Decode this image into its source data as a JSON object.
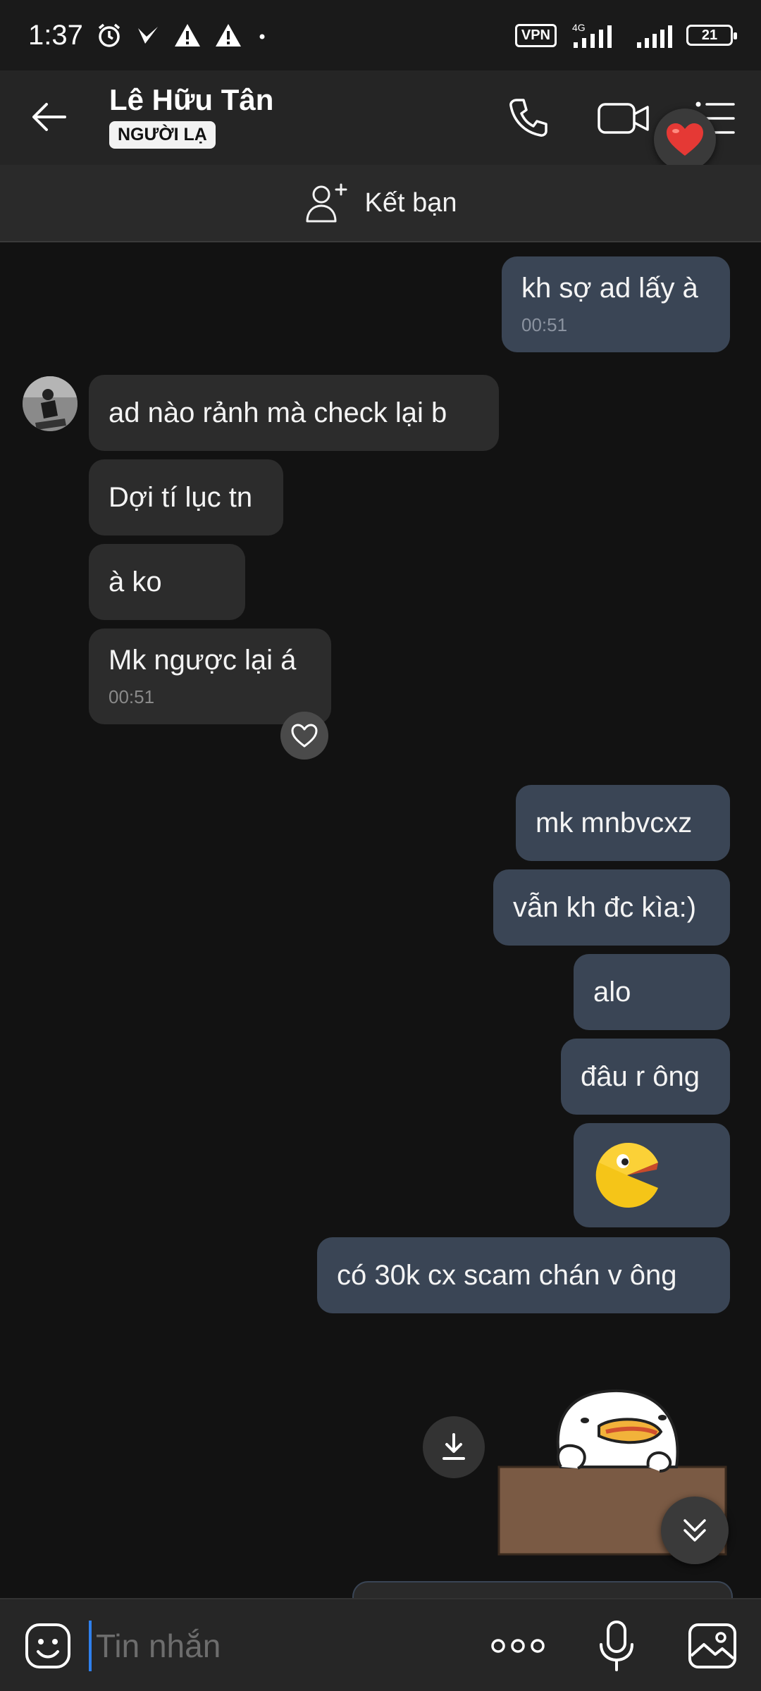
{
  "status_bar": {
    "time": "1:37",
    "vpn": "VPN",
    "network": "4G",
    "battery": "21"
  },
  "header": {
    "contact_name": "Lê Hữu Tân",
    "badge": "NGƯỜI LẠ"
  },
  "add_friend": {
    "label": "Kết bạn"
  },
  "messages": [
    {
      "dir": "out",
      "text": "kh sợ ad lấy à",
      "time": "00:51"
    },
    {
      "dir": "in",
      "text": "ad nào rảnh mà check lại b"
    },
    {
      "dir": "in",
      "text": "Dợi tí lục tn"
    },
    {
      "dir": "in",
      "text": "à ko"
    },
    {
      "dir": "in",
      "text": "Mk ngược lại á",
      "time": "00:51"
    },
    {
      "dir": "out",
      "text": "mk mnbvcxz"
    },
    {
      "dir": "out",
      "text": "vẫn kh đc kìa:)"
    },
    {
      "dir": "out",
      "text": "alo"
    },
    {
      "dir": "out",
      "text": "đâu r ông"
    },
    {
      "dir": "out",
      "text": "có 30k cx scam chán v ông"
    }
  ],
  "composer": {
    "placeholder": "Tin nhắn"
  },
  "colors": {
    "background": "#121212",
    "incoming_bubble": "#2c2c2c",
    "outgoing_bubble": "#3a4555",
    "accent": "#2f80ed",
    "heart": "#e53935"
  }
}
